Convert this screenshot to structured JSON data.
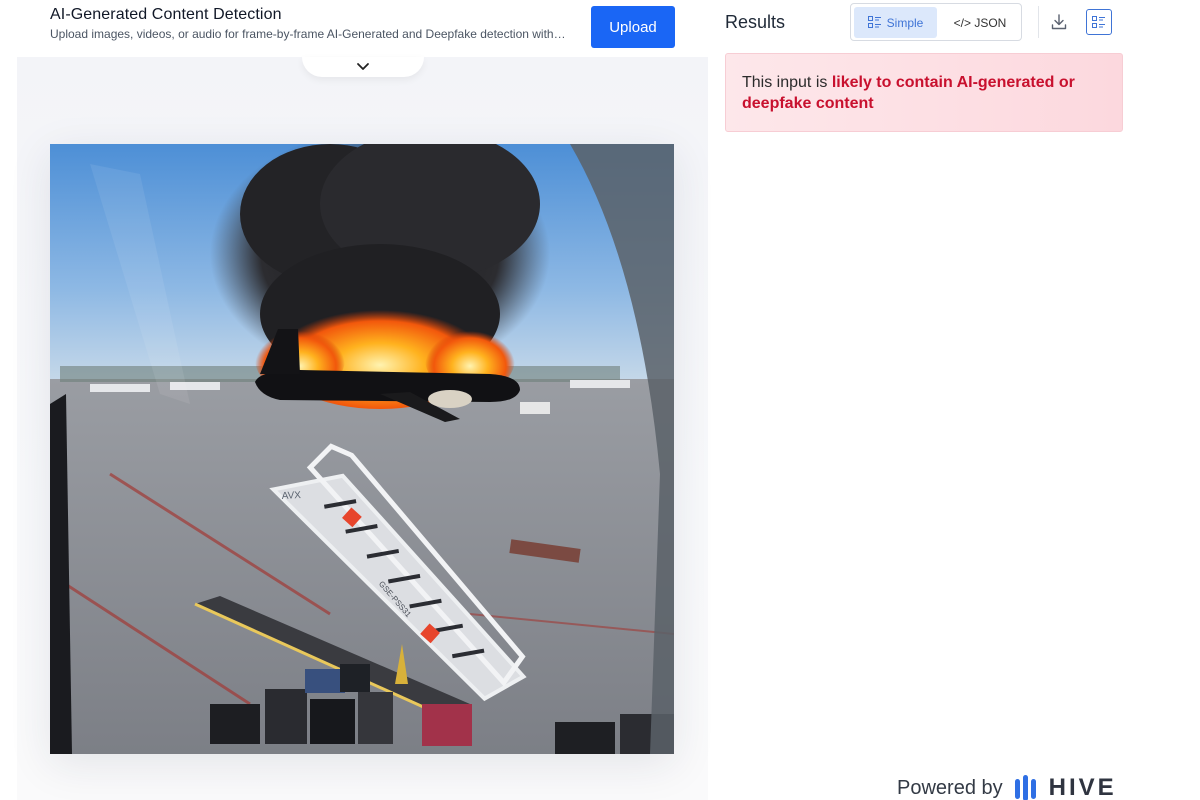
{
  "header": {
    "title": "AI-Generated Content Detection",
    "subtitle": "Upload images, videos, or audio for frame-by-frame AI-Generated and Deepfake detection with…",
    "upload_label": "Upload"
  },
  "preview": {
    "collapse_icon": "chevron-down-icon",
    "image_text": {
      "stairs_logo": "AVX",
      "stairs_id": "GSE-PSS31"
    }
  },
  "results": {
    "title": "Results",
    "view_toggle": {
      "simple_label": "Simple",
      "json_label": "</> JSON",
      "selected": "Simple"
    },
    "icons": [
      "download-icon",
      "list-view-icon"
    ],
    "verdict": {
      "prefix": "This input is ",
      "highlight": "likely to contain AI-generated or deepfake content"
    }
  },
  "footer": {
    "powered_by": "Powered by",
    "brand": "HIVE"
  },
  "colors": {
    "accent": "#1a66f5",
    "toggle_active_bg": "#dce8fb",
    "verdict_bg": "#fde7ea",
    "verdict_highlight": "#c8102e"
  }
}
